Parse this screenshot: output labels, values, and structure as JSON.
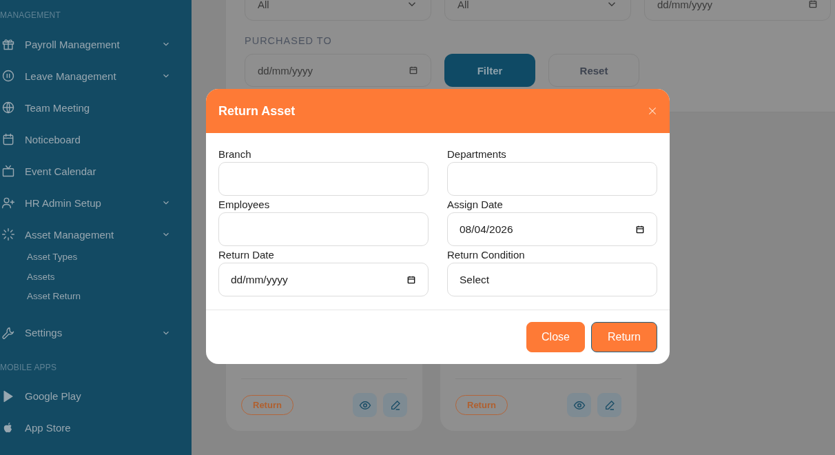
{
  "sidebar": {
    "sections": [
      {
        "label": "MANAGEMENT",
        "items": [
          {
            "label": "Payroll Management",
            "dropdown": true
          },
          {
            "label": "Leave Management",
            "dropdown": true
          },
          {
            "label": "Team Meeting",
            "dropdown": false
          },
          {
            "label": "Noticeboard",
            "dropdown": false
          },
          {
            "label": "Event Calendar",
            "dropdown": false
          },
          {
            "label": "HR Admin Setup",
            "dropdown": true
          },
          {
            "label": "Asset Management",
            "dropdown": true,
            "children": [
              {
                "label": "Asset Types"
              },
              {
                "label": "Assets"
              },
              {
                "label": "Asset Return"
              }
            ]
          },
          {
            "label": "Settings",
            "dropdown": true
          }
        ]
      },
      {
        "label": "MOBILE APPS",
        "items": [
          {
            "label": "Google Play",
            "dropdown": false
          },
          {
            "label": "App Store",
            "dropdown": false
          }
        ]
      }
    ]
  },
  "filters": {
    "fields": [
      {
        "kind": "select",
        "value": "All"
      },
      {
        "kind": "select",
        "value": "All"
      },
      {
        "kind": "date",
        "placeholder": "dd/mm/yyyy"
      }
    ],
    "purchased_to": {
      "label": "PURCHASED TO",
      "placeholder": "dd/mm/yyyy"
    },
    "buttons": [
      {
        "label": "Filter",
        "kind": "primary"
      },
      {
        "label": "Reset",
        "kind": "secondary"
      }
    ]
  },
  "cards": [
    {
      "button": "Return"
    },
    {
      "button": "Return"
    }
  ],
  "modal": {
    "title": "Return Asset",
    "fields": [
      {
        "label": "Branch",
        "kind": "text"
      },
      {
        "label": "Departments",
        "kind": "text"
      },
      {
        "label": "Employees",
        "kind": "text"
      },
      {
        "label": "Assign Date",
        "kind": "date",
        "value": "08/04/2026"
      },
      {
        "label": "Return Date",
        "kind": "date",
        "placeholder": "dd/mm/yyyy"
      },
      {
        "label": "Return Condition",
        "kind": "select",
        "value": "Select"
      }
    ],
    "buttons": [
      {
        "label": "Close",
        "kind": "secondary"
      },
      {
        "label": "Return",
        "kind": "primary"
      }
    ]
  }
}
